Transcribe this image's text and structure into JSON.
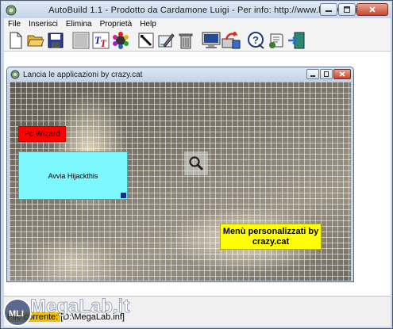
{
  "window": {
    "title": "AutoBuild 1.1  -  Prodotto da Cardamone Luigi  -  Per info: http://www.lcs.3000.it"
  },
  "menu": [
    "File",
    "Inserisci",
    "Elimina",
    "Proprietà",
    "Help"
  ],
  "toolbar": {
    "icons": [
      "new-file-icon",
      "open-folder-icon",
      "save-disk-icon",
      "gray-square-icon",
      "font-tt-icon",
      "color-palette-icon",
      "pick-tool-icon",
      "edit-image-icon",
      "trash-icon",
      "monitor-icon",
      "run-program-icon",
      "help-icon",
      "info-scroll-icon",
      "exit-door-icon"
    ]
  },
  "child_window": {
    "title": "Lancia le applicazioni by crazy.cat",
    "buttons": {
      "wizard": "Pc Wizard",
      "hijack": "Avvia Hijackthis",
      "custom_menu": "Menù personalizzati by crazy.cat"
    }
  },
  "status": {
    "prefix": "File corrente: ",
    "path": "[D:\\MegaLab.inf]"
  },
  "watermark": {
    "text": "MegaLab.it",
    "badge": "MLI"
  }
}
